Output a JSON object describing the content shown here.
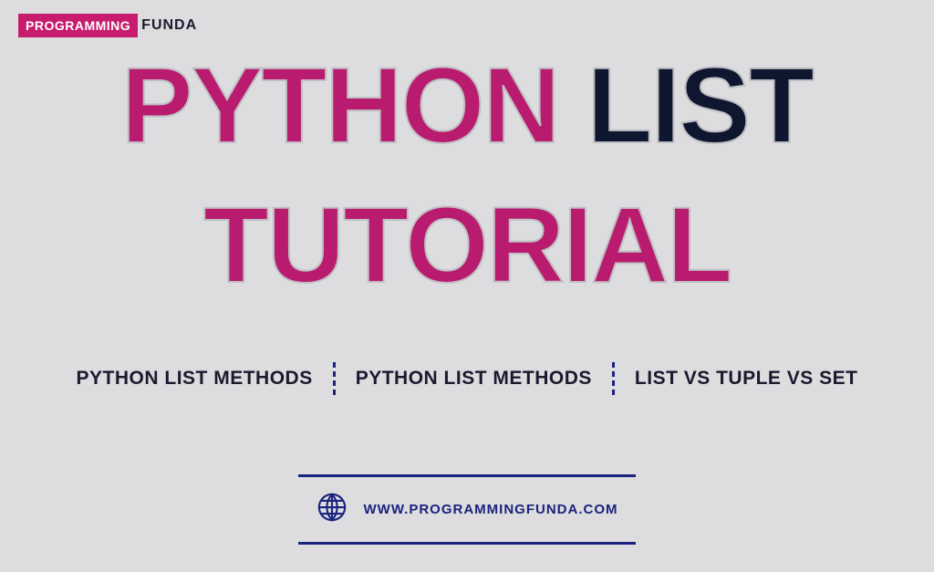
{
  "logo": {
    "box_text": "PROGRAMMING",
    "suffix_text": "FUNDA"
  },
  "title": {
    "line1_word1": "PYTHON",
    "line1_word2": "LIST",
    "line2": "TUTORIAL"
  },
  "topics": [
    "PYTHON LIST METHODS",
    "PYTHON LIST METHODS",
    "LIST VS TUPLE VS SET"
  ],
  "footer": {
    "url": "WWW.PROGRAMMINGFUNDA.COM"
  }
}
